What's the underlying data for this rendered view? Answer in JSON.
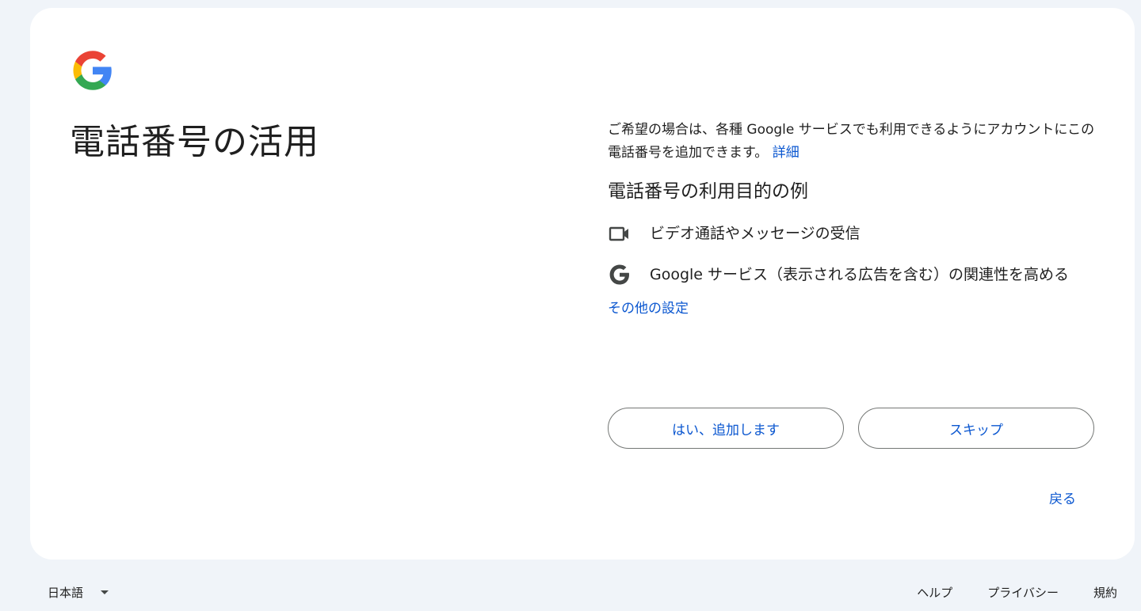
{
  "page": {
    "title": "電話番号の活用",
    "description": "ご希望の場合は、各種 Google サービスでも利用できるようにアカウントにこの電話番号を追加できます。",
    "details_link": "詳細",
    "examples_heading": "電話番号の利用目的の例",
    "features": [
      {
        "icon": "video-camera-icon",
        "text": "ビデオ通話やメッセージの受信"
      },
      {
        "icon": "google-g-icon",
        "text": "Google サービス（表示される広告を含む）の関連性を高める"
      }
    ],
    "more_settings_link": "その他の設定",
    "yes_button": "はい、追加します",
    "skip_button": "スキップ",
    "back_link": "戻る"
  },
  "footer": {
    "language": "日本語",
    "help": "ヘルプ",
    "privacy": "プライバシー",
    "terms": "規約"
  },
  "colors": {
    "background": "#f0f4f9",
    "card": "#ffffff",
    "link": "#0b57d0",
    "text": "#1f1f1f",
    "button_border": "#747775"
  }
}
